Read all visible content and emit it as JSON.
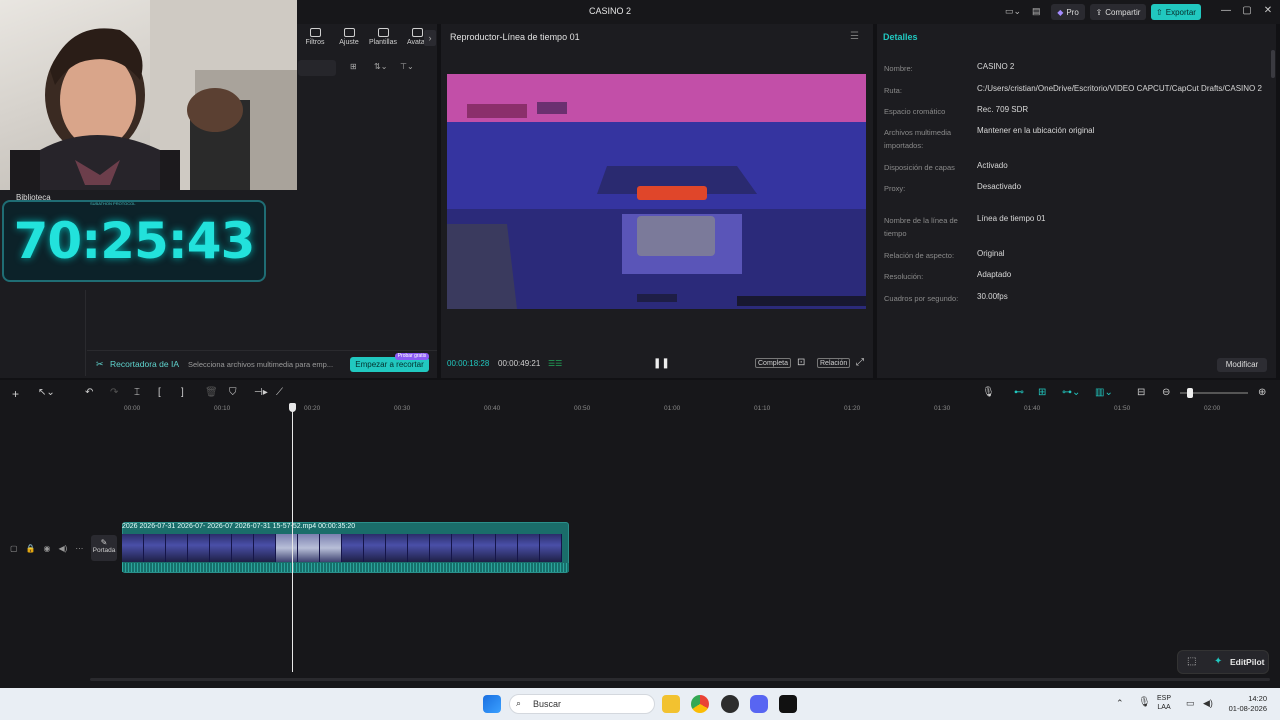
{
  "app": {
    "title": "CASINO 2",
    "pro_label": "Pro",
    "share_label": "Compartir",
    "export_label": "Exportar",
    "accent": "#21c8c0"
  },
  "toolbar_tabs": [
    {
      "label": "Filtros",
      "icon": "filters-icon"
    },
    {
      "label": "Ajuste",
      "icon": "adjust-icon"
    },
    {
      "label": "Plantillas",
      "icon": "templates-icon"
    },
    {
      "label": "Avatar",
      "icon": "avatar-icon"
    }
  ],
  "overlay": {
    "library_label": "Biblioteca",
    "timer": "70:25:43",
    "timer_caption": "SUBATHON PROTOCOL"
  },
  "ai_recorder": {
    "label": "Recortadora de IA",
    "description": "Selecciona archivos multimedia para emp...",
    "start_label": "Empezar a recortar",
    "badge": "Probar gratis"
  },
  "player": {
    "title": "Reproductor-Línea de tiempo 01",
    "current_time": "00:00:18:28",
    "total_time": "00:00:49:21",
    "full_label": "Completa",
    "ratio_label": "Relación"
  },
  "details": {
    "title": "Detalles",
    "rows": [
      {
        "key": "Nombre:",
        "value": "CASINO 2"
      },
      {
        "key": "Ruta:",
        "value": "C:/Users/cristian/OneDrive/Escritorio/VIDEO CAPCUT/CapCut Drafts/CASINO 2"
      },
      {
        "key": "Espacio cromático",
        "value": "Rec. 709 SDR"
      },
      {
        "key": "Archivos multimedia importados:",
        "value": "Mantener en la ubicación original"
      },
      {
        "key": "Disposición de capas",
        "value": "Activado"
      },
      {
        "key": "Proxy:",
        "value": "Desactivado"
      },
      {
        "key": "Nombre de la línea de tiempo",
        "value": "Línea de tiempo 01"
      },
      {
        "key": "Relación de aspecto:",
        "value": "Original"
      },
      {
        "key": "Resolución:",
        "value": "Adaptado"
      },
      {
        "key": "Cuadros por segundo:",
        "value": "30.00fps"
      }
    ],
    "modify_label": "Modificar"
  },
  "timeline": {
    "ruler": [
      "00:00",
      "00:10",
      "00:20",
      "00:30",
      "00:40",
      "00:50",
      "01:00",
      "01:10",
      "01:20",
      "01:30",
      "01:40",
      "01:50",
      "02:00"
    ],
    "clip_labels": "2026 2026-07-31   2026-07-   2026-07   2026-07-31 15-57-52.mp4   00:00:35:20",
    "cover_label": "Portada"
  },
  "editpilot": {
    "label": "EditPilot"
  },
  "taskbar": {
    "search_placeholder": "Buscar",
    "lang": "ESP",
    "lang_sub": "LAA",
    "time": "14:20",
    "date": "01-08-2026"
  }
}
